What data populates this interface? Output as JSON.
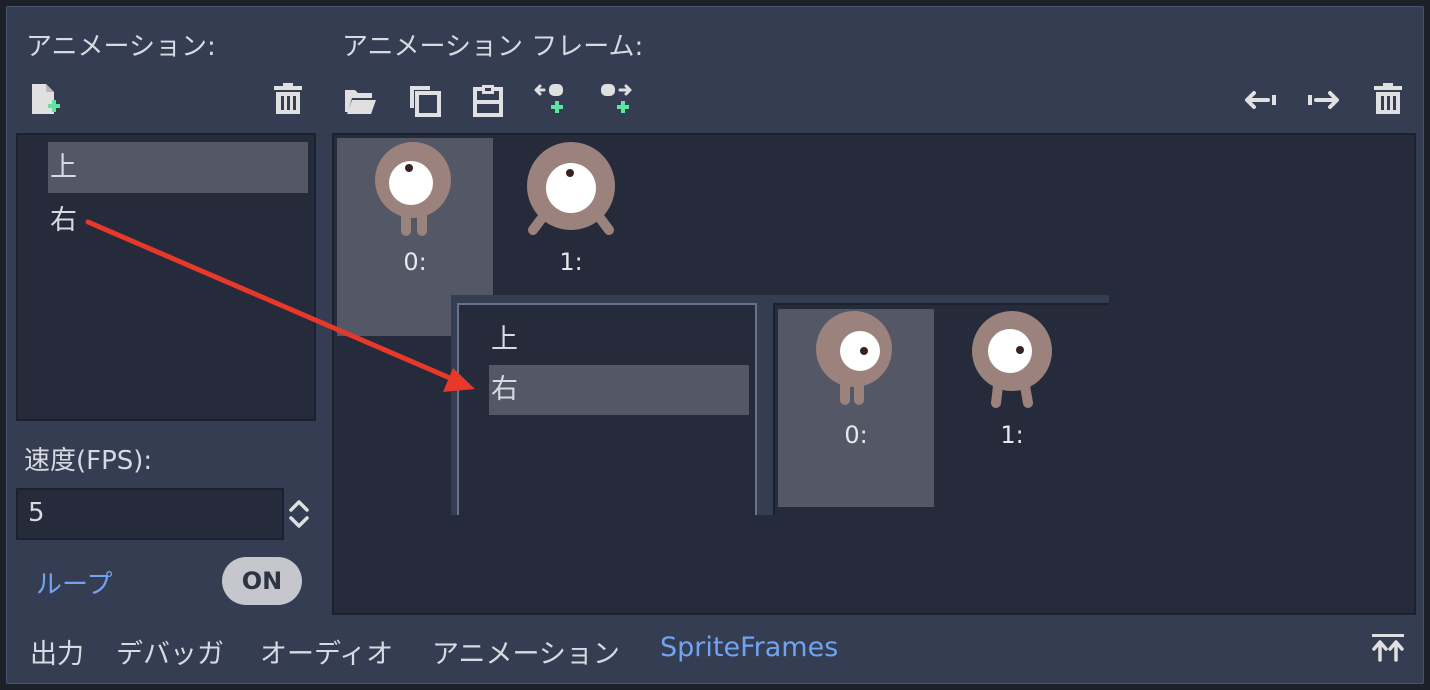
{
  "left_panel": {
    "title": "アニメーション:",
    "animations": [
      {
        "label": "上",
        "selected": true
      },
      {
        "label": "右",
        "selected": false
      }
    ],
    "speed_label": "速度(FPS):",
    "speed_value": "5",
    "loop_label": "ループ",
    "loop_toggle": "ON"
  },
  "frames_panel": {
    "title": "アニメーション フレーム:",
    "toolbar_left": [
      "open-folder-icon",
      "copy-icon",
      "paste-icon",
      "insert-before-icon",
      "insert-after-icon"
    ],
    "toolbar_right": [
      "move-left-icon",
      "move-right-icon",
      "trash-icon"
    ],
    "frames": [
      {
        "caption": "0:",
        "selected": true
      },
      {
        "caption": "1:",
        "selected": false
      }
    ]
  },
  "inset": {
    "animations": [
      {
        "label": "上",
        "selected": false
      },
      {
        "label": "右",
        "selected": true
      }
    ],
    "frames": [
      {
        "caption": "0:",
        "selected": true
      },
      {
        "caption": "1:",
        "selected": false
      }
    ]
  },
  "bottom_tabs": [
    {
      "label": "出力",
      "active": false
    },
    {
      "label": "デバッガ",
      "active": false
    },
    {
      "label": "オーディオ",
      "active": false
    },
    {
      "label": "アニメーション",
      "active": false
    },
    {
      "label": "SpriteFrames",
      "active": true
    }
  ],
  "colors": {
    "accent": "#72a3f0",
    "arrow": "#e8382a",
    "add_green": "#5fe3a1",
    "sprite_body": "#9c827c"
  }
}
